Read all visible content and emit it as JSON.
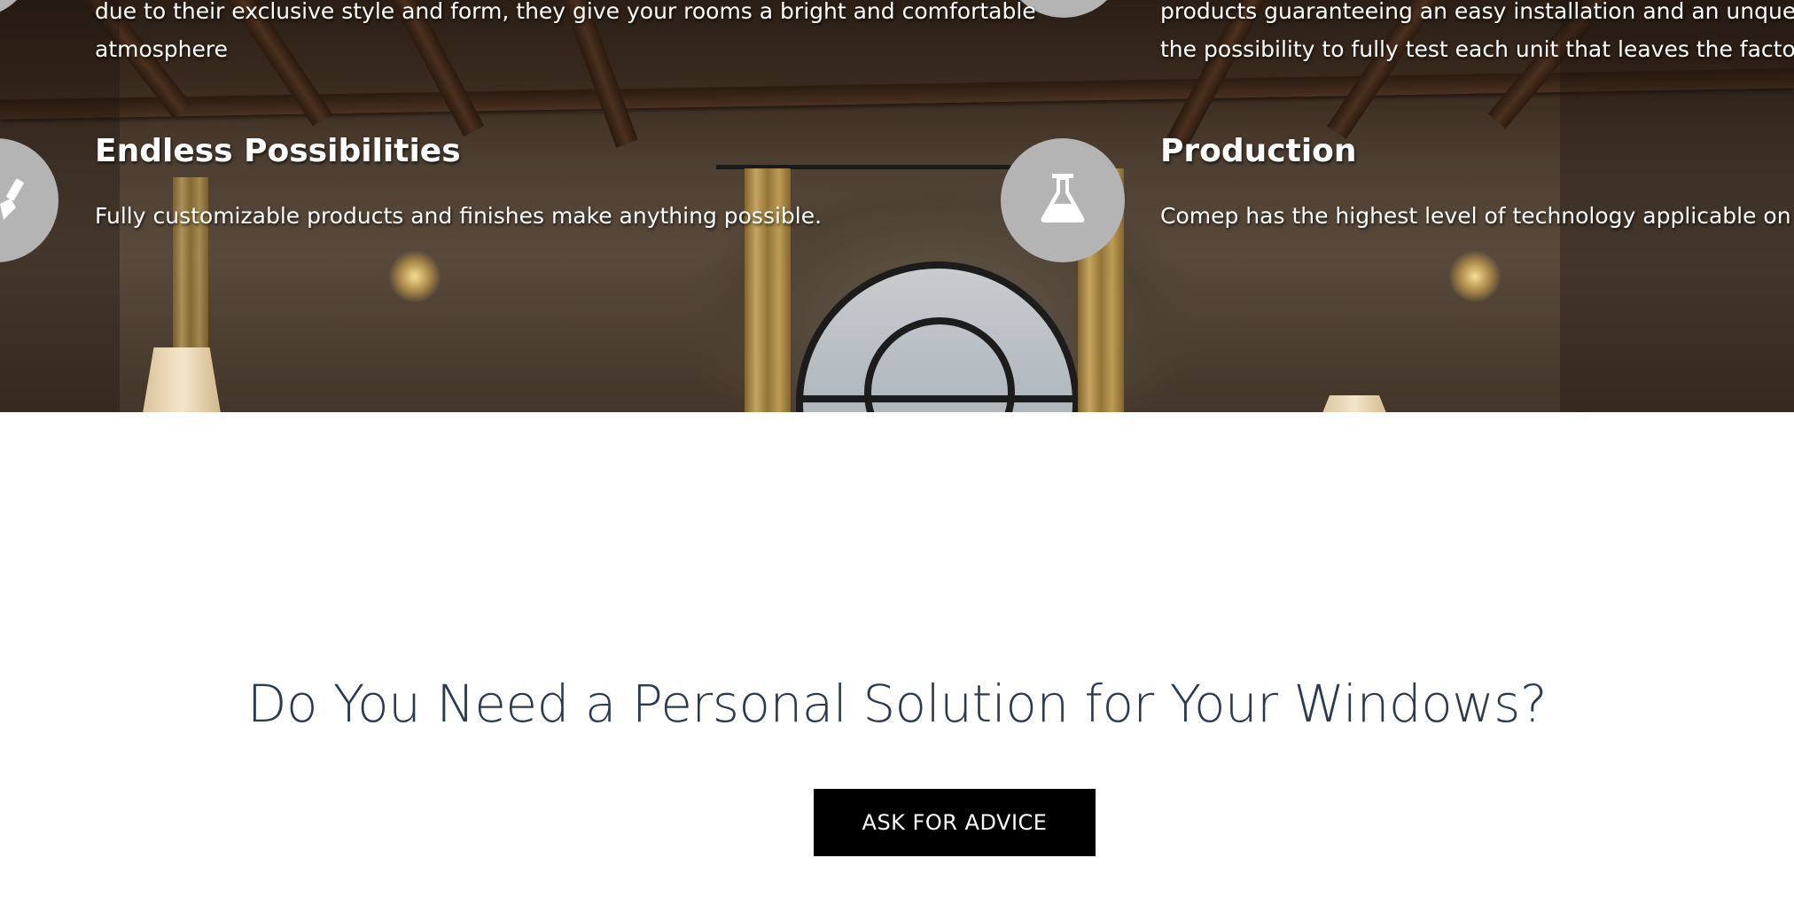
{
  "features": {
    "top_left_text_line1": "due to their exclusive style and form, they give your rooms a bright and comfortable",
    "top_left_text_line2": "atmosphere",
    "top_right_text_line1": "products guaranteeing an easy installation and an unquesti",
    "top_right_text_line2": "the possibility to fully test each unit that leaves the factory.",
    "endless": {
      "title": "Endless Possibilities",
      "text": "Fully customizable products and finishes make anything possible.",
      "icon": "paintbrush-icon"
    },
    "production": {
      "title": "Production",
      "text": "Comep has the highest level of technology applicable on the",
      "icon": "flask-icon"
    }
  },
  "cta": {
    "heading": "Do You Need a Personal Solution for Your Windows?",
    "button_label": "ASK FOR ADVICE"
  },
  "colors": {
    "heading": "#2c3a4e",
    "button_bg": "#000000",
    "icon_circle": "#b4b4b4"
  }
}
